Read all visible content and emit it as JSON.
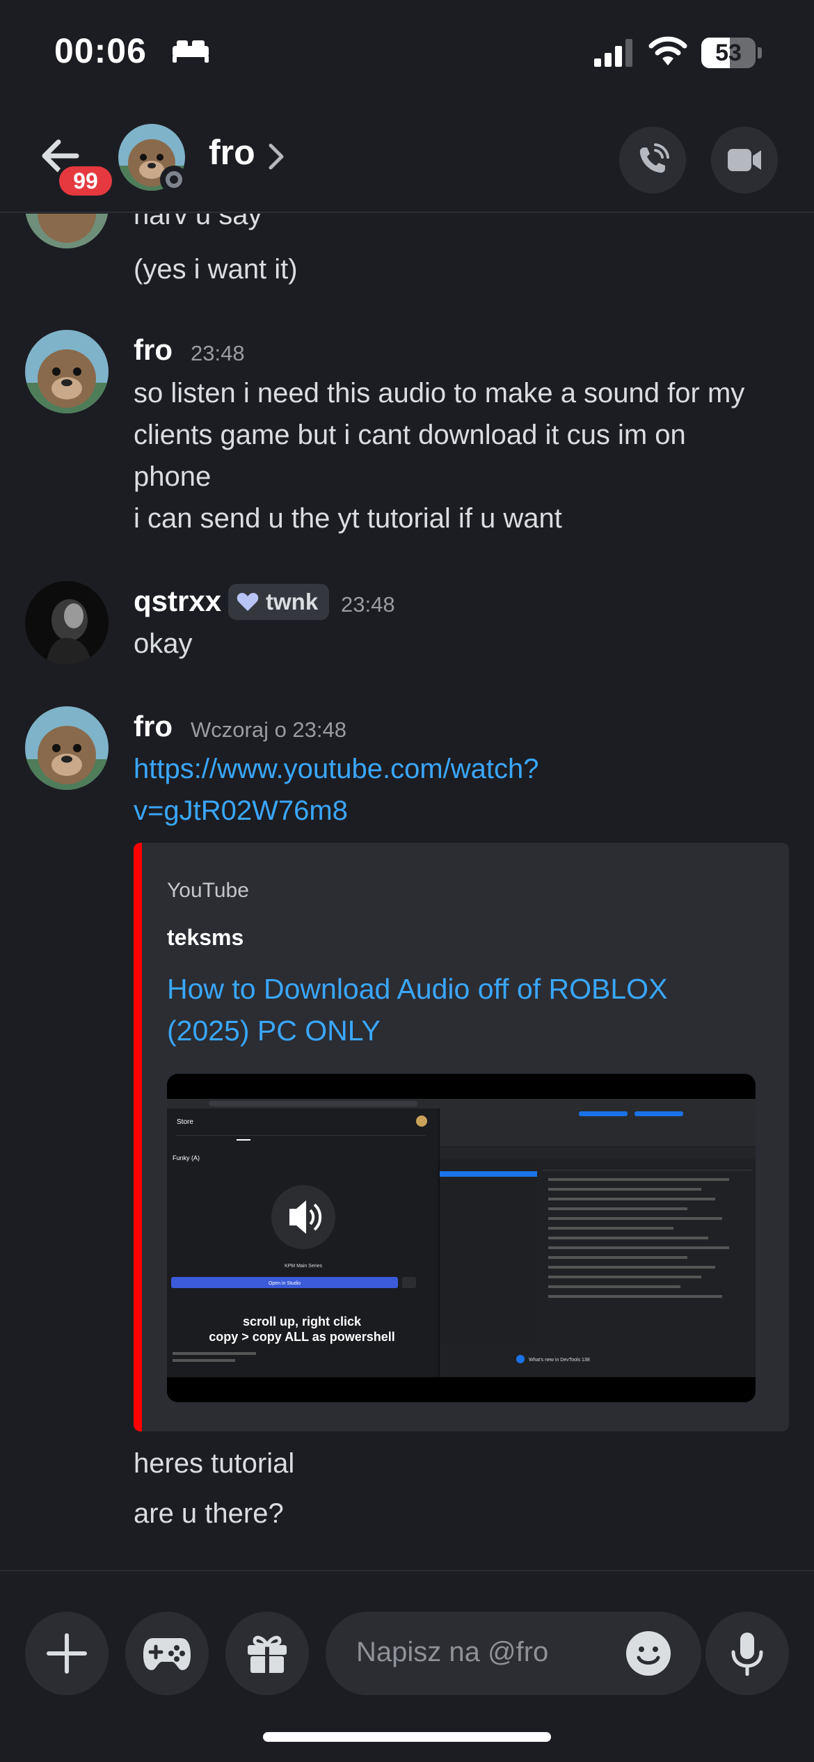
{
  "status_bar": {
    "time": "00:06",
    "battery": "53",
    "battery_level_percent": 53
  },
  "header": {
    "unread_count": "99",
    "contact_name": "fro"
  },
  "messages": {
    "top_partial": [
      "harv u say",
      "(yes i want it)"
    ],
    "group1": {
      "author": "fro",
      "time": "23:48",
      "lines": [
        "so listen i need this audio to make a sound for my",
        "clients game but i cant download it cus im on",
        "phone",
        "i can send u the yt tutorial if u want"
      ]
    },
    "group2": {
      "author": "qstrxx",
      "badge": "twnk",
      "time": "23:48",
      "lines": [
        "okay"
      ]
    },
    "group3": {
      "author": "fro",
      "time": "Wczoraj o 23:48",
      "link_lines": [
        "https://www.youtube.com/watch?",
        "v=gJtR02W76m8"
      ],
      "embed": {
        "provider": "YouTube",
        "author": "teksms",
        "title_lines": [
          "How to Download Audio off of ROBLOX",
          "(2025) PC ONLY"
        ],
        "thumbnail_caption_1": "scroll up, right click",
        "thumbnail_caption_2": "copy > copy ALL as powershell",
        "thumbnail_store": "Store",
        "thumbnail_track": "Funky (A)",
        "thumbnail_open_btn": "Open in Studio",
        "thumbnail_artist": "KPM Main Series",
        "thumbnail_devtools": "What's new in DevTools 138"
      },
      "after_lines": [
        "heres tutorial",
        "are u there?"
      ]
    }
  },
  "composer": {
    "placeholder": "Napisz na @fro"
  },
  "colors": {
    "background": "#1c1d22",
    "link": "#3aa7ff",
    "embed_bar": "#ff0000",
    "badge_red": "#e5393f"
  }
}
